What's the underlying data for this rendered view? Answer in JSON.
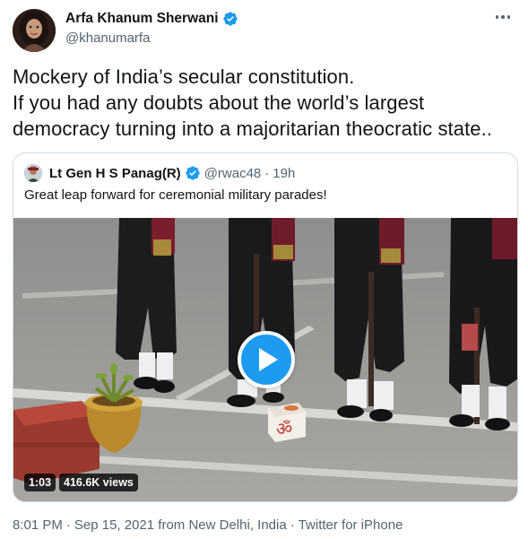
{
  "author": {
    "name": "Arfa Khanum Sherwani",
    "handle": "@khanumarfa",
    "verified": true
  },
  "tweet_lines": [
    "Mockery of India’s secular constitution.",
    "If you had any doubts about the world’s largest",
    "democracy turning into a majoritarian theocratic state.."
  ],
  "quoted": {
    "name": "Lt Gen H S Panag(R)",
    "handle": "@rwac48",
    "separator": "·",
    "time": "19h",
    "text": "Great leap forward for ceremonial military parades!",
    "video": {
      "duration": "1:03",
      "views": "416.6K views",
      "icon": "play-icon"
    }
  },
  "footer": {
    "time": "8:01 PM",
    "sep1": "·",
    "date": "Sep 15, 2021 from New Delhi, India",
    "sep2": "·",
    "source": "Twitter for iPhone"
  },
  "colors": {
    "accent": "#1d9bf0",
    "text": "#0f1419",
    "secondary": "#536471",
    "border": "#cfd9de"
  }
}
